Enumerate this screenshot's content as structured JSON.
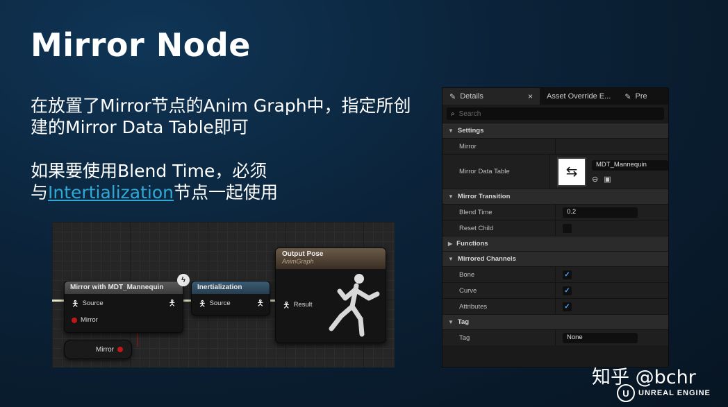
{
  "slide": {
    "title": "Mirror Node",
    "para1": "在放置了Mirror节点的Anim Graph中，指定所创建的Mirror Data Table即可",
    "para2_line1": "如果要使用Blend Time，必须",
    "para2_prefix": "与",
    "para2_link": "Intertialization",
    "para2_suffix": "节点一起使用"
  },
  "graph": {
    "mirror_node": {
      "title": "Mirror with MDT_Mannequin",
      "pin_source": "Source",
      "pin_mirror": "Mirror",
      "head_color": "#4a4a4a"
    },
    "inertial_node": {
      "title": "Inertialization",
      "pin_source": "Source",
      "head_color": "#2f4a5e"
    },
    "output_node": {
      "title": "Output Pose",
      "subtitle": "AnimGraph",
      "pin_result": "Result",
      "head_color": "#5a4a3a"
    },
    "mirror_var": {
      "label": "Mirror"
    }
  },
  "details": {
    "tabs": [
      {
        "label": "Details",
        "icon": "pencil-icon"
      },
      {
        "label": "Asset Override E..."
      },
      {
        "label": "Pre",
        "icon": "pencil-icon"
      }
    ],
    "search_placeholder": "Search",
    "categories": {
      "settings": "Settings",
      "mirror_transition": "Mirror Transition",
      "functions": "Functions",
      "mirrored_channels": "Mirrored Channels",
      "tag": "Tag"
    },
    "rows": {
      "mirror": "Mirror",
      "mirror_data_table": "Mirror Data Table",
      "mdt_value": "MDT_Mannequin",
      "blend_time": "Blend Time",
      "blend_time_value": "0.2",
      "reset_child": "Reset Child",
      "bone": "Bone",
      "curve": "Curve",
      "attributes": "Attributes",
      "tag": "Tag",
      "tag_value": "None"
    },
    "checks": {
      "reset_child": false,
      "bone": true,
      "curve": true,
      "attributes": true
    }
  },
  "watermark": "知乎 @bchr",
  "ue_brand": "UNREAL ENGINE"
}
